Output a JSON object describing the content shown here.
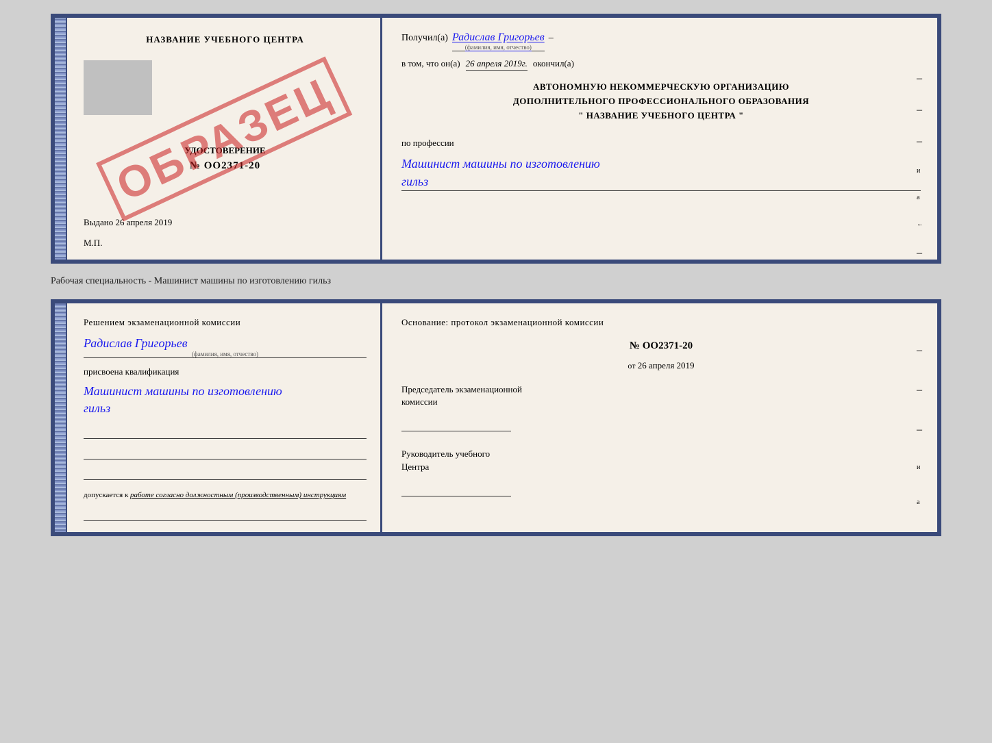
{
  "top_doc": {
    "left": {
      "title": "НАЗВАНИЕ УЧЕБНОГО ЦЕНТРА",
      "cert_label": "УДОСТОВЕРЕНИЕ",
      "cert_number": "№ OO2371-20",
      "date_prefix": "Выдано",
      "date_value": "26 апреля 2019",
      "mp_label": "М.П.",
      "stamp_text": "ОБРАЗЕЦ"
    },
    "right": {
      "received_prefix": "Получил(а)",
      "received_name": "Радислав Григорьев",
      "received_sublabel": "(фамилия, имя, отчество)",
      "date_prefix": "в том, что он(а)",
      "date_value": "26 апреля 2019г.",
      "date_suffix": "окончил(а)",
      "org_line1": "АВТОНОМНУЮ НЕКОММЕРЧЕСКУЮ ОРГАНИЗАЦИЮ",
      "org_line2": "ДОПОЛНИТЕЛЬНОГО ПРОФЕССИОНАЛЬНОГО ОБРАЗОВАНИЯ",
      "org_line3": "\"   НАЗВАНИЕ УЧЕБНОГО ЦЕНТРА   \"",
      "profession_label": "по профессии",
      "profession_value": "Машинист машины по изготовлению",
      "profession_value2": "гильз"
    }
  },
  "between": {
    "label": "Рабочая специальность - Машинист машины по изготовлению гильз"
  },
  "bottom_doc": {
    "left": {
      "decision_text": "Решением  экзаменационной  комиссии",
      "name_value": "Радислав Григорьев",
      "name_sublabel": "(фамилия, имя, отчество)",
      "qualification_prefix": "присвоена квалификация",
      "qualification_value": "Машинист машины по изготовлению",
      "qualification_value2": "гильз",
      "admit_prefix": "допускается к",
      "admit_italic": "работе согласно должностным (производственным) инструкциям"
    },
    "right": {
      "basis_text": "Основание:  протокол  экзаменационной  комиссии",
      "protocol_number": "№  OO2371-20",
      "protocol_date_prefix": "от",
      "protocol_date_value": "26 апреля 2019",
      "chairman_label1": "Председатель экзаменационной",
      "chairman_label2": "комиссии",
      "head_label1": "Руководитель учебного",
      "head_label2": "Центра"
    }
  },
  "dashes": [
    "-",
    "-",
    "-",
    "и",
    "а",
    "←",
    "-",
    "-",
    "-"
  ],
  "dashes_bot": [
    "-",
    "-",
    "-",
    "и",
    "а",
    "←",
    "-",
    "-",
    "-"
  ]
}
